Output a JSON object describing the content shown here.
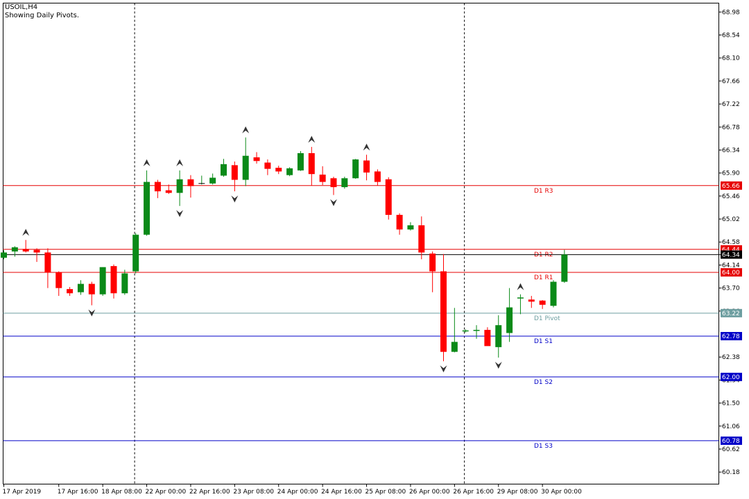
{
  "header": {
    "symbol": "USOIL,H4",
    "subtitle": "Showing Daily Pivots."
  },
  "colors": {
    "up_candle": "#0a8a18",
    "down_candle": "#ff0000",
    "r_levels": "#e60000",
    "pivot": "#6d9ea0",
    "s_levels": "#0000c8",
    "current_price_line": "#000000",
    "fractal": "#333333"
  },
  "chart_data": {
    "type": "candlestick",
    "ylim": [
      59.95,
      69.15
    ],
    "y_ticks": [
      "68.98",
      "68.54",
      "68.10",
      "67.66",
      "67.22",
      "66.78",
      "66.34",
      "65.90",
      "65.46",
      "65.02",
      "64.58",
      "64.34",
      "64.14",
      "63.70",
      "63.26",
      "62.38",
      "61.94",
      "61.50",
      "61.06",
      "60.62",
      "60.18"
    ],
    "x_ticks": [
      {
        "index": 0,
        "label": "17 Apr 2019"
      },
      {
        "index": 5,
        "label": "17 Apr 16:00"
      },
      {
        "index": 9,
        "label": "18 Apr 08:00"
      },
      {
        "index": 13,
        "label": "22 Apr 00:00"
      },
      {
        "index": 17,
        "label": "22 Apr 16:00"
      },
      {
        "index": 21,
        "label": "23 Apr 08:00"
      },
      {
        "index": 25,
        "label": "24 Apr 00:00"
      },
      {
        "index": 29,
        "label": "24 Apr 16:00"
      },
      {
        "index": 33,
        "label": "25 Apr 08:00"
      },
      {
        "index": 37,
        "label": "26 Apr 00:00"
      },
      {
        "index": 41,
        "label": "26 Apr 16:00"
      },
      {
        "index": 45,
        "label": "29 Apr 08:00"
      },
      {
        "index": 49,
        "label": "30 Apr 00:00"
      }
    ],
    "day_separators": [
      11.9,
      41.9
    ],
    "candles": [
      {
        "o": 64.28,
        "h": 64.42,
        "l": 64.25,
        "c": 64.38
      },
      {
        "o": 64.4,
        "h": 64.5,
        "l": 64.3,
        "c": 64.48
      },
      {
        "o": 64.45,
        "h": 64.62,
        "l": 64.38,
        "c": 64.4
      },
      {
        "o": 64.43,
        "h": 64.46,
        "l": 64.2,
        "c": 64.38
      },
      {
        "o": 64.38,
        "h": 64.46,
        "l": 63.7,
        "c": 64.0
      },
      {
        "o": 64.0,
        "h": 64.02,
        "l": 63.55,
        "c": 63.7
      },
      {
        "o": 63.68,
        "h": 63.72,
        "l": 63.55,
        "c": 63.6
      },
      {
        "o": 63.62,
        "h": 63.85,
        "l": 63.57,
        "c": 63.78
      },
      {
        "o": 63.78,
        "h": 63.82,
        "l": 63.37,
        "c": 63.58
      },
      {
        "o": 63.58,
        "h": 64.1,
        "l": 63.55,
        "c": 64.1
      },
      {
        "o": 64.12,
        "h": 64.15,
        "l": 63.5,
        "c": 63.6
      },
      {
        "o": 63.6,
        "h": 64.05,
        "l": 63.57,
        "c": 63.98
      },
      {
        "o": 64.02,
        "h": 64.75,
        "l": 63.98,
        "c": 64.72
      },
      {
        "o": 64.72,
        "h": 65.95,
        "l": 64.7,
        "c": 65.73
      },
      {
        "o": 65.73,
        "h": 65.77,
        "l": 65.42,
        "c": 65.55
      },
      {
        "o": 65.57,
        "h": 65.68,
        "l": 65.5,
        "c": 65.52
      },
      {
        "o": 65.52,
        "h": 65.95,
        "l": 65.27,
        "c": 65.78
      },
      {
        "o": 65.78,
        "h": 65.86,
        "l": 65.43,
        "c": 65.65
      },
      {
        "o": 65.7,
        "h": 65.85,
        "l": 65.68,
        "c": 65.7
      },
      {
        "o": 65.7,
        "h": 65.89,
        "l": 65.68,
        "c": 65.81
      },
      {
        "o": 65.85,
        "h": 66.17,
        "l": 65.83,
        "c": 66.07
      },
      {
        "o": 66.05,
        "h": 66.12,
        "l": 65.55,
        "c": 65.77
      },
      {
        "o": 65.77,
        "h": 66.58,
        "l": 65.65,
        "c": 66.23
      },
      {
        "o": 66.2,
        "h": 66.3,
        "l": 66.08,
        "c": 66.13
      },
      {
        "o": 66.1,
        "h": 66.16,
        "l": 65.86,
        "c": 65.98
      },
      {
        "o": 66.0,
        "h": 66.04,
        "l": 65.88,
        "c": 65.93
      },
      {
        "o": 65.86,
        "h": 66.01,
        "l": 65.84,
        "c": 65.99
      },
      {
        "o": 65.95,
        "h": 66.32,
        "l": 65.94,
        "c": 66.28
      },
      {
        "o": 66.28,
        "h": 66.4,
        "l": 65.66,
        "c": 65.88
      },
      {
        "o": 65.87,
        "h": 66.03,
        "l": 65.67,
        "c": 65.73
      },
      {
        "o": 65.8,
        "h": 65.83,
        "l": 65.48,
        "c": 65.63
      },
      {
        "o": 65.63,
        "h": 65.83,
        "l": 65.6,
        "c": 65.8
      },
      {
        "o": 65.8,
        "h": 66.17,
        "l": 65.79,
        "c": 66.16
      },
      {
        "o": 66.14,
        "h": 66.25,
        "l": 65.76,
        "c": 65.91
      },
      {
        "o": 65.93,
        "h": 65.97,
        "l": 65.66,
        "c": 65.73
      },
      {
        "o": 65.78,
        "h": 65.82,
        "l": 65.01,
        "c": 65.1
      },
      {
        "o": 65.1,
        "h": 65.13,
        "l": 64.72,
        "c": 64.82
      },
      {
        "o": 64.82,
        "h": 64.96,
        "l": 64.8,
        "c": 64.9
      },
      {
        "o": 64.9,
        "h": 65.07,
        "l": 64.25,
        "c": 64.38
      },
      {
        "o": 64.36,
        "h": 64.4,
        "l": 63.62,
        "c": 64.02
      },
      {
        "o": 64.02,
        "h": 64.35,
        "l": 62.3,
        "c": 62.48
      },
      {
        "o": 62.48,
        "h": 63.32,
        "l": 62.47,
        "c": 62.67
      },
      {
        "o": 62.87,
        "h": 62.91,
        "l": 62.85,
        "c": 62.89
      },
      {
        "o": 62.88,
        "h": 62.99,
        "l": 62.73,
        "c": 62.9
      },
      {
        "o": 62.9,
        "h": 62.95,
        "l": 62.6,
        "c": 62.59
      },
      {
        "o": 62.57,
        "h": 63.18,
        "l": 62.37,
        "c": 62.99
      },
      {
        "o": 62.84,
        "h": 63.7,
        "l": 62.67,
        "c": 63.33
      },
      {
        "o": 63.5,
        "h": 63.58,
        "l": 63.2,
        "c": 63.52
      },
      {
        "o": 63.48,
        "h": 63.55,
        "l": 63.32,
        "c": 63.44
      },
      {
        "o": 63.46,
        "h": 63.47,
        "l": 63.3,
        "c": 63.38
      },
      {
        "o": 63.36,
        "h": 63.85,
        "l": 63.33,
        "c": 63.82
      },
      {
        "o": 63.82,
        "h": 64.43,
        "l": 63.8,
        "c": 64.34
      }
    ],
    "fractals_up": [
      2,
      13,
      16,
      22,
      28,
      33,
      47
    ],
    "fractals_down": [
      8,
      16,
      21,
      30,
      40,
      45
    ],
    "pivot_levels": [
      {
        "name": "D1 R3",
        "value": 65.66,
        "label": "65.66",
        "group": "r"
      },
      {
        "name": "D1 R2",
        "value": 64.44,
        "label": "64.44",
        "group": "r"
      },
      {
        "name": "D1 R1",
        "value": 64.0,
        "label": "64.00",
        "group": "r"
      },
      {
        "name": "D1 Pivot",
        "value": 63.22,
        "label": "63.22",
        "group": "p"
      },
      {
        "name": "D1 S1",
        "value": 62.78,
        "label": "62.78",
        "group": "s"
      },
      {
        "name": "D1 S2",
        "value": 62.0,
        "label": "62.00",
        "group": "s"
      },
      {
        "name": "D1 S3",
        "value": 60.78,
        "label": "60.78",
        "group": "s"
      }
    ],
    "current_price": {
      "value": 64.34,
      "label": "64.34"
    }
  }
}
